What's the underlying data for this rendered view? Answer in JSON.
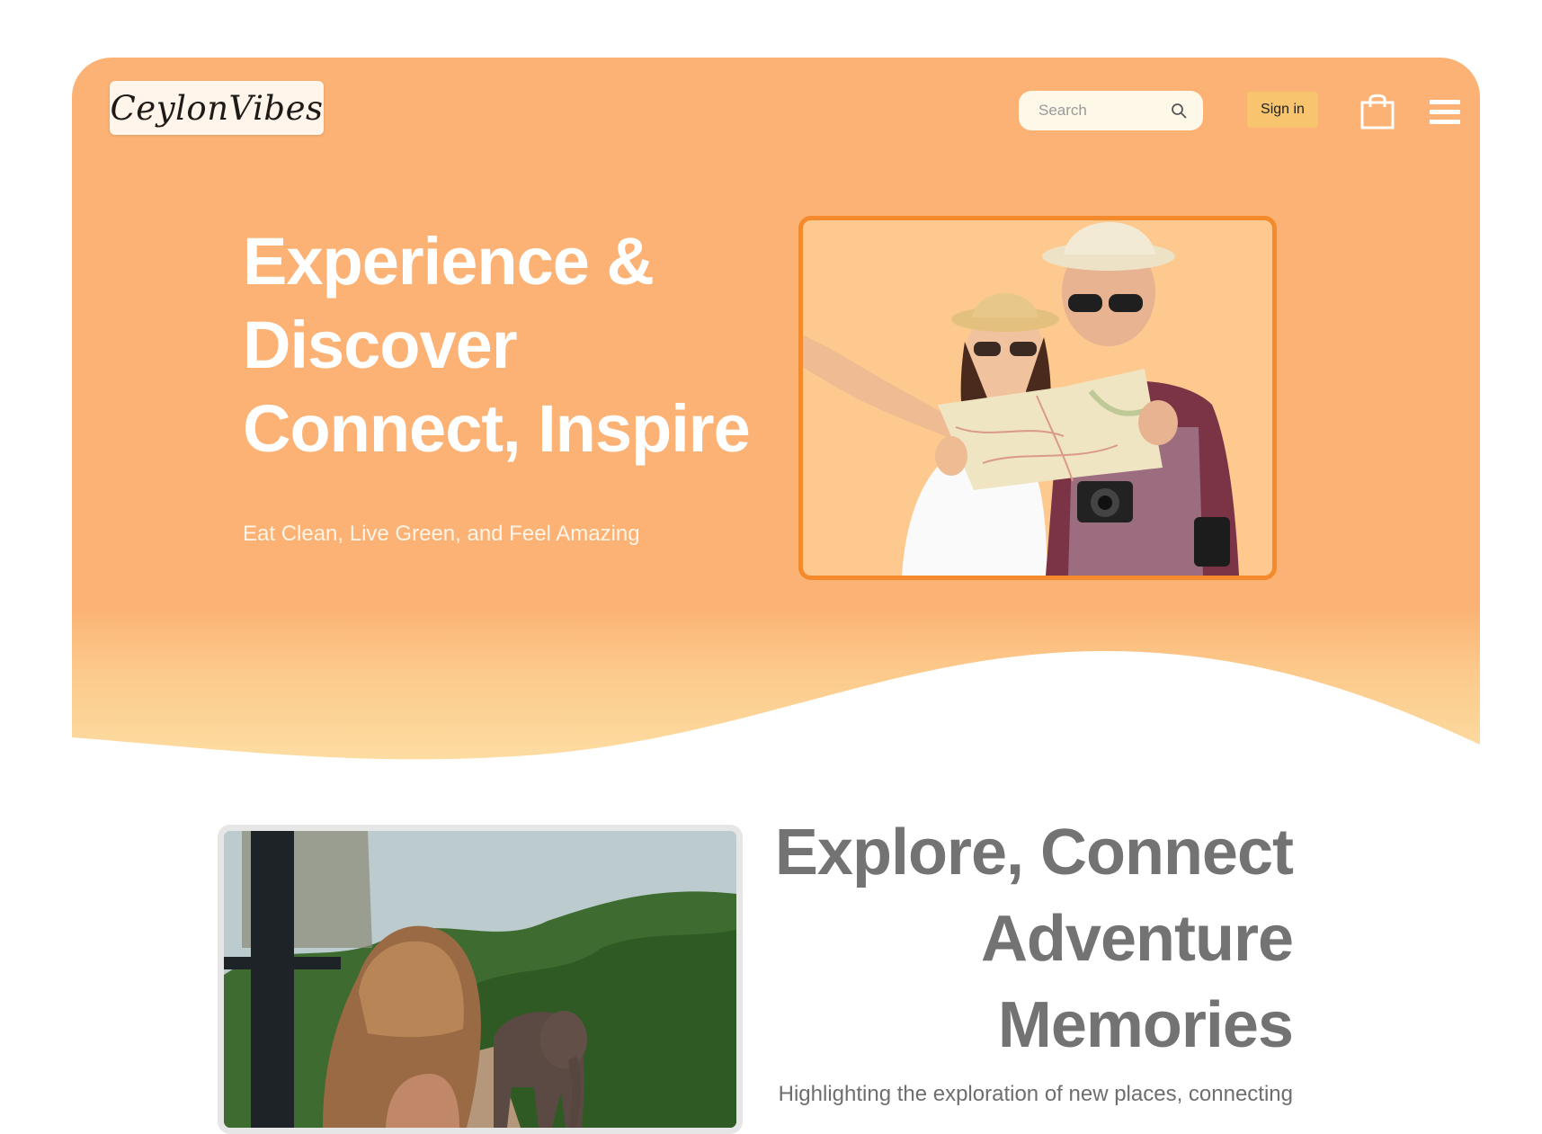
{
  "brand": {
    "logo_text": "CeylonVibes"
  },
  "header": {
    "search_placeholder": "Search",
    "signin_label": "Sign in",
    "icons": [
      "search-icon",
      "shopping-bag-icon",
      "menu-icon"
    ]
  },
  "hero": {
    "headline_line1": "Experience &",
    "headline_line2": "Discover",
    "headline_line3": "Connect, Inspire",
    "tagline": "Eat Clean, Live Green, and Feel Amazing"
  },
  "section2": {
    "headline_line1": "Explore, Connect",
    "headline_line2": "Adventure",
    "headline_line3": "Memories",
    "subtext": "Highlighting the exploration of new places, connecting"
  },
  "colors": {
    "hero_orange": "#fbb274",
    "frame_orange": "#f48a2c",
    "signin_yellow": "#f8c56e",
    "heading_gray": "#737373"
  }
}
